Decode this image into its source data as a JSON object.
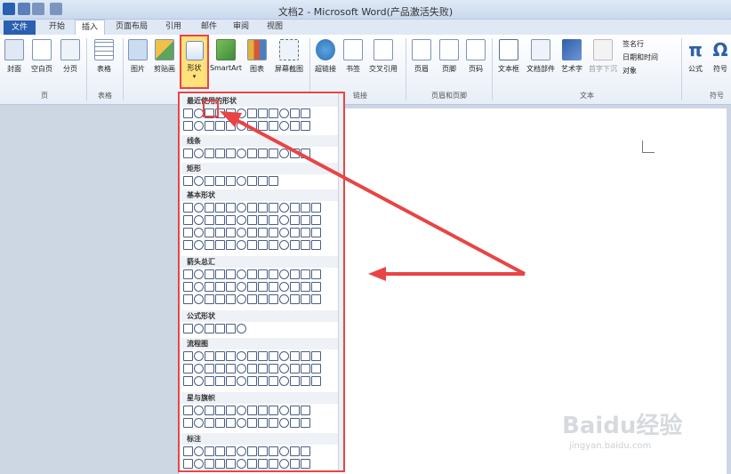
{
  "title": "文档2 - Microsoft Word(产品激活失败)",
  "tabs": [
    "文件",
    "开始",
    "插入",
    "页面布局",
    "引用",
    "邮件",
    "审阅",
    "视图"
  ],
  "active_tab": "插入",
  "ribbon": {
    "page_group": {
      "buttons": [
        "封面",
        "空白页",
        "分页"
      ],
      "label": "页"
    },
    "table_group": {
      "buttons": [
        "表格"
      ],
      "label": "表格"
    },
    "illustrations": {
      "buttons": [
        "图片",
        "剪贴画",
        "形状",
        "SmartArt",
        "图表",
        "屏幕截图"
      ]
    },
    "links": {
      "buttons": [
        "超链接",
        "书签",
        "交叉引用"
      ],
      "label": "链接"
    },
    "header_footer": {
      "buttons": [
        "页眉",
        "页脚",
        "页码"
      ],
      "label": "页眉和页脚"
    },
    "text": {
      "buttons": [
        "文本框",
        "文档部件",
        "艺术字",
        "首字下沉"
      ],
      "small": [
        "签名行",
        "日期和时间",
        "对象"
      ],
      "label": "文本"
    },
    "symbols": {
      "buttons": [
        "公式",
        "符号"
      ],
      "label": "符号"
    }
  },
  "shapes_gallery": {
    "categories": [
      "最近使用的形状",
      "线条",
      "矩形",
      "基本形状",
      "箭头总汇",
      "公式形状",
      "流程图",
      "星与旗帜",
      "标注"
    ]
  },
  "watermark": {
    "brand": "Baidu经验",
    "url": "jingyan.baidu.com"
  },
  "colors": {
    "highlight": "#e94444",
    "ribbon_bg": "#e8eef7",
    "file_tab": "#2b5fb0"
  }
}
